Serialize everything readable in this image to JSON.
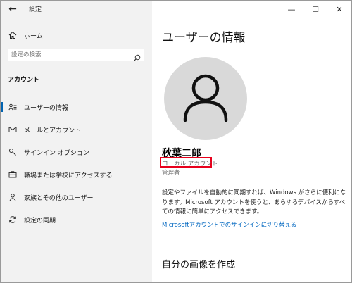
{
  "window": {
    "title": "設定",
    "controls": {
      "minimize": "—",
      "maximize": "☐",
      "close": "✕"
    }
  },
  "sidebar": {
    "home_label": "ホーム",
    "search_placeholder": "設定の検索",
    "section_header": "アカウント",
    "items": [
      {
        "label": "ユーザーの情報",
        "icon": "user-info-icon",
        "selected": true
      },
      {
        "label": "メールとアカウント",
        "icon": "mail-icon",
        "selected": false
      },
      {
        "label": "サインイン オプション",
        "icon": "key-icon",
        "selected": false
      },
      {
        "label": "職場または学校にアクセスする",
        "icon": "briefcase-icon",
        "selected": false
      },
      {
        "label": "家族とその他のユーザー",
        "icon": "person-icon",
        "selected": false
      },
      {
        "label": "設定の同期",
        "icon": "sync-icon",
        "selected": false
      }
    ]
  },
  "main": {
    "title": "ユーザーの情報",
    "user_name": "秋葉二郎",
    "account_type": "ローカル アカウント",
    "account_role": "管理者",
    "description": "設定やファイルを自動的に同期すれば、Windows がさらに便利になります。Microsoft アカウントを使うと、あらゆるデバイスからすべての情報に簡単にアクセスできます。",
    "ms_link": "Microsoftアカウントでのサインインに切り替える",
    "create_picture_title": "自分の画像を作成"
  },
  "colors": {
    "accent": "#0063b1",
    "link": "#0067c0",
    "highlight": "#e8001c",
    "sidebar_bg": "#f2f2f2",
    "avatar_bg": "#d9d9d9"
  }
}
